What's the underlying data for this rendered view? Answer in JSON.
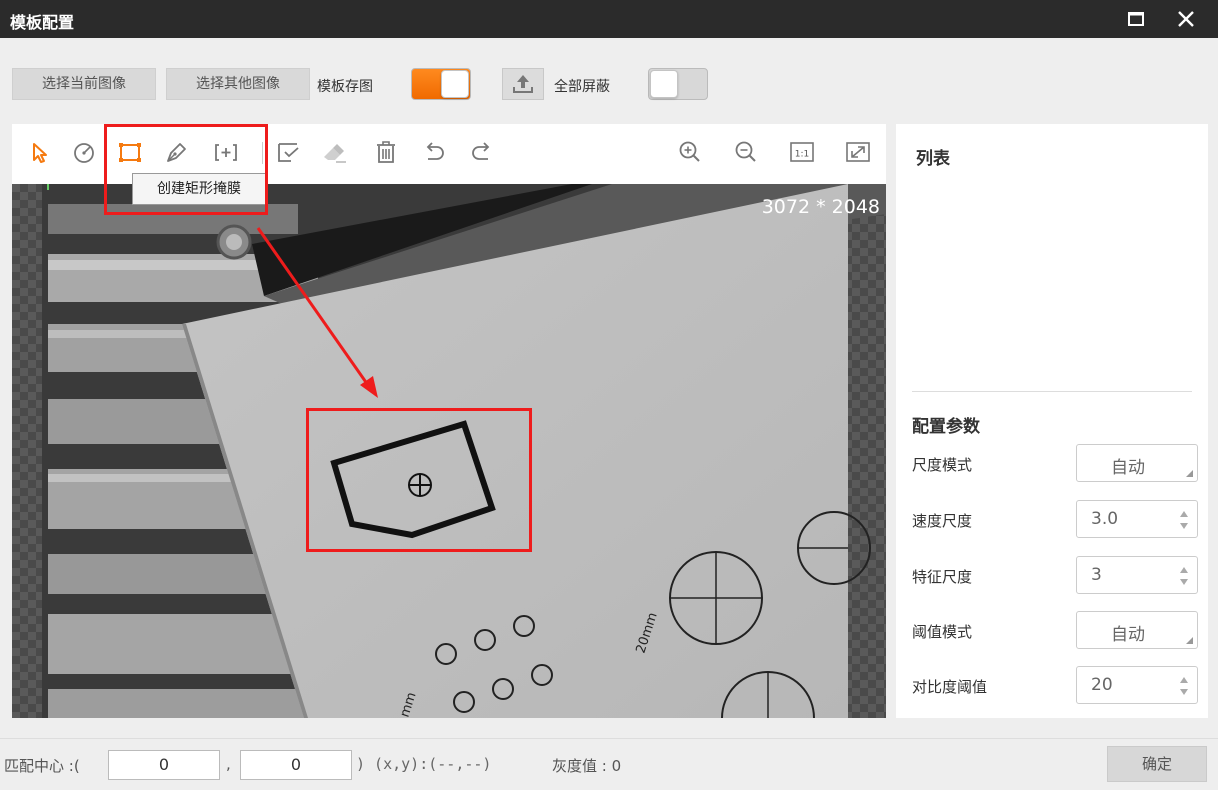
{
  "window": {
    "title": "模板配置",
    "maximize_icon": "maximize-icon",
    "close_icon": "close-icon"
  },
  "topbar": {
    "select_current_image": "选择当前图像",
    "select_other_image": "选择其他图像",
    "template_save_label": "模板存图",
    "template_save_on": true,
    "upload_icon": "upload-icon",
    "mask_all_label": "全部屏蔽",
    "mask_all_on": false
  },
  "canvas": {
    "tools": [
      "select-pointer-icon",
      "circle-mask-icon",
      "rectangle-mask-icon",
      "pen-mask-icon",
      "add-region-icon",
      "edit-check-icon",
      "eraser-icon",
      "delete-icon",
      "undo-icon",
      "redo-icon",
      "zoom-in-icon",
      "zoom-out-icon",
      "actual-size-icon",
      "fit-window-icon"
    ],
    "tooltip": "创建矩形掩膜",
    "actual_size_label": "1:1",
    "resolution": "3072 * 2048",
    "photo_label": "20mm",
    "photo_label2": "mm"
  },
  "right_panel": {
    "list_title": "列表",
    "config_title": "配置参数",
    "params": [
      {
        "label": "尺度模式",
        "value": "自动",
        "type": "select"
      },
      {
        "label": "速度尺度",
        "value": "3.0",
        "type": "spin"
      },
      {
        "label": "特征尺度",
        "value": "3",
        "type": "spin"
      },
      {
        "label": "阈值模式",
        "value": "自动",
        "type": "select"
      },
      {
        "label": "对比度阈值",
        "value": "20",
        "type": "spin"
      }
    ]
  },
  "bottombar": {
    "match_center_label": "匹配中心 :(",
    "x_value": "0",
    "comma": ",",
    "y_value": "0",
    "coord_text": ")  (x,y):(--,--)",
    "gray_label": "灰度值 : 0",
    "ok_label": "确定"
  },
  "colors": {
    "accent": "#f57a10",
    "annotation": "#ee1c1c",
    "titlebar": "#2b2b2b"
  }
}
